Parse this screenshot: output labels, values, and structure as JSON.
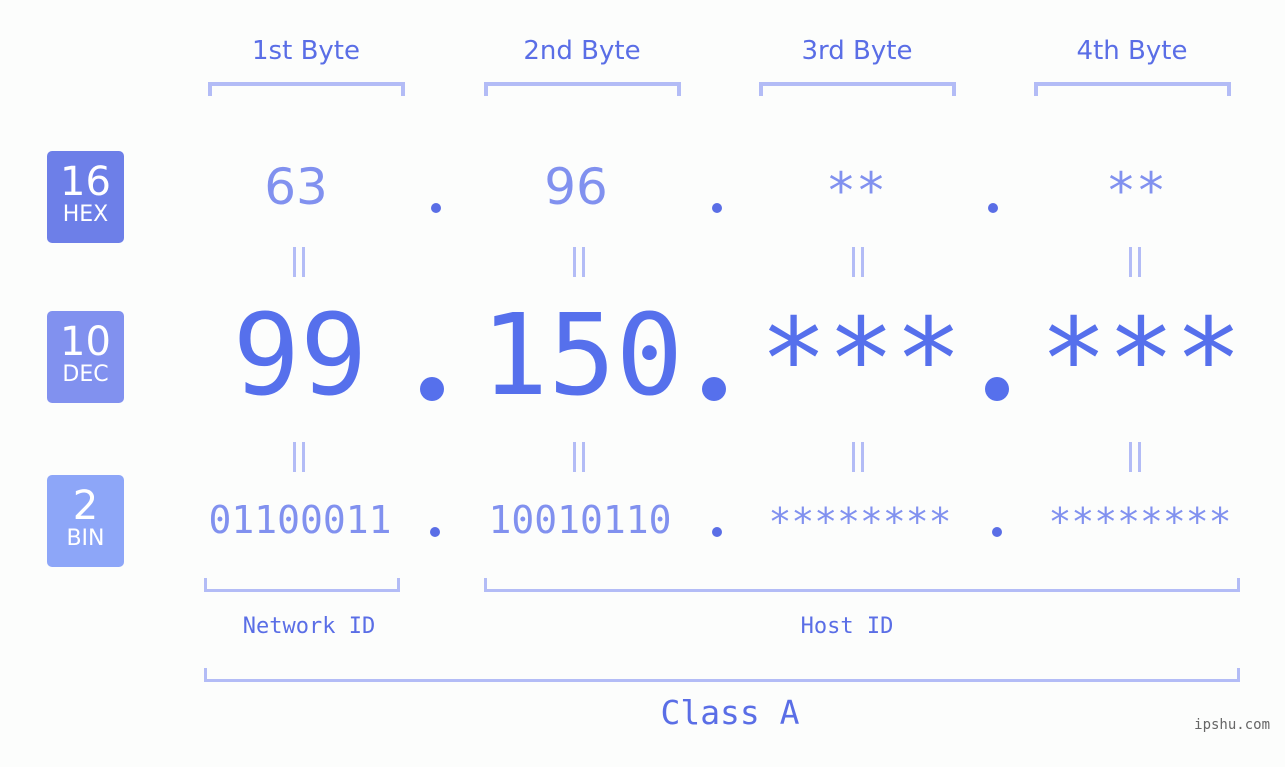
{
  "badges": [
    {
      "base": "16",
      "label": "HEX"
    },
    {
      "base": "10",
      "label": "DEC"
    },
    {
      "base": "2",
      "label": "BIN"
    }
  ],
  "bytes": [
    {
      "header": "1st Byte",
      "hex": "63",
      "dec": "99",
      "bin": "01100011"
    },
    {
      "header": "2nd Byte",
      "hex": "96",
      "dec": "150",
      "bin": "10010110"
    },
    {
      "header": "3rd Byte",
      "hex": "**",
      "dec": "***",
      "bin": "********"
    },
    {
      "header": "4th Byte",
      "hex": "**",
      "dec": "***",
      "bin": "********"
    }
  ],
  "separator": ".",
  "network_label": "Network ID",
  "host_label": "Host ID",
  "class_label": "Class A",
  "watermark": "ipshu.com",
  "colors": {
    "primary": "#5670ec",
    "light": "#8191ef",
    "bracket": "#b3bcf6",
    "badge_hex": "#6d7fe8",
    "badge_dec": "#8191ef",
    "badge_bin": "#8da6f8"
  }
}
